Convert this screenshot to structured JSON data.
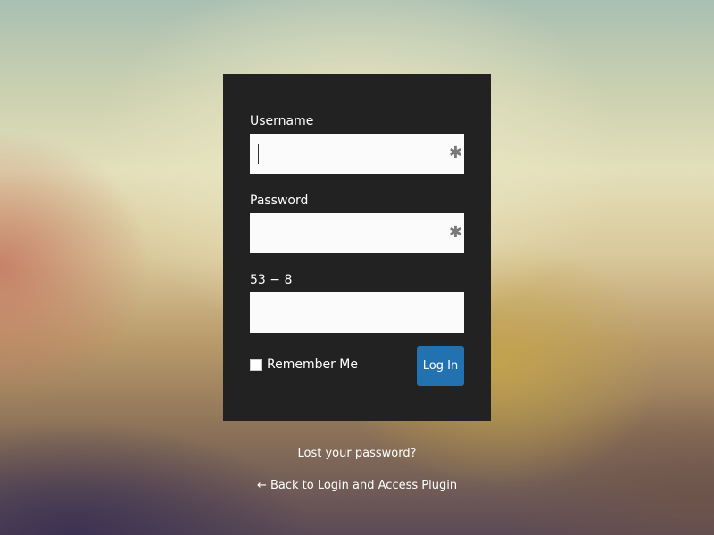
{
  "login_form": {
    "username_label": "Username",
    "username_value": "",
    "password_label": "Password",
    "password_value": "",
    "captcha_label": "53 − 8",
    "captcha_value": "",
    "required_marker": "✱",
    "remember_label": "Remember Me",
    "remember_checked": false,
    "submit_label": "Log In",
    "submit_color": "#2271b1",
    "panel_color": "#222222"
  },
  "footer_links": {
    "lost_password": "Lost your password?",
    "back_to_site": "← Back to Login and Access Plugin"
  }
}
